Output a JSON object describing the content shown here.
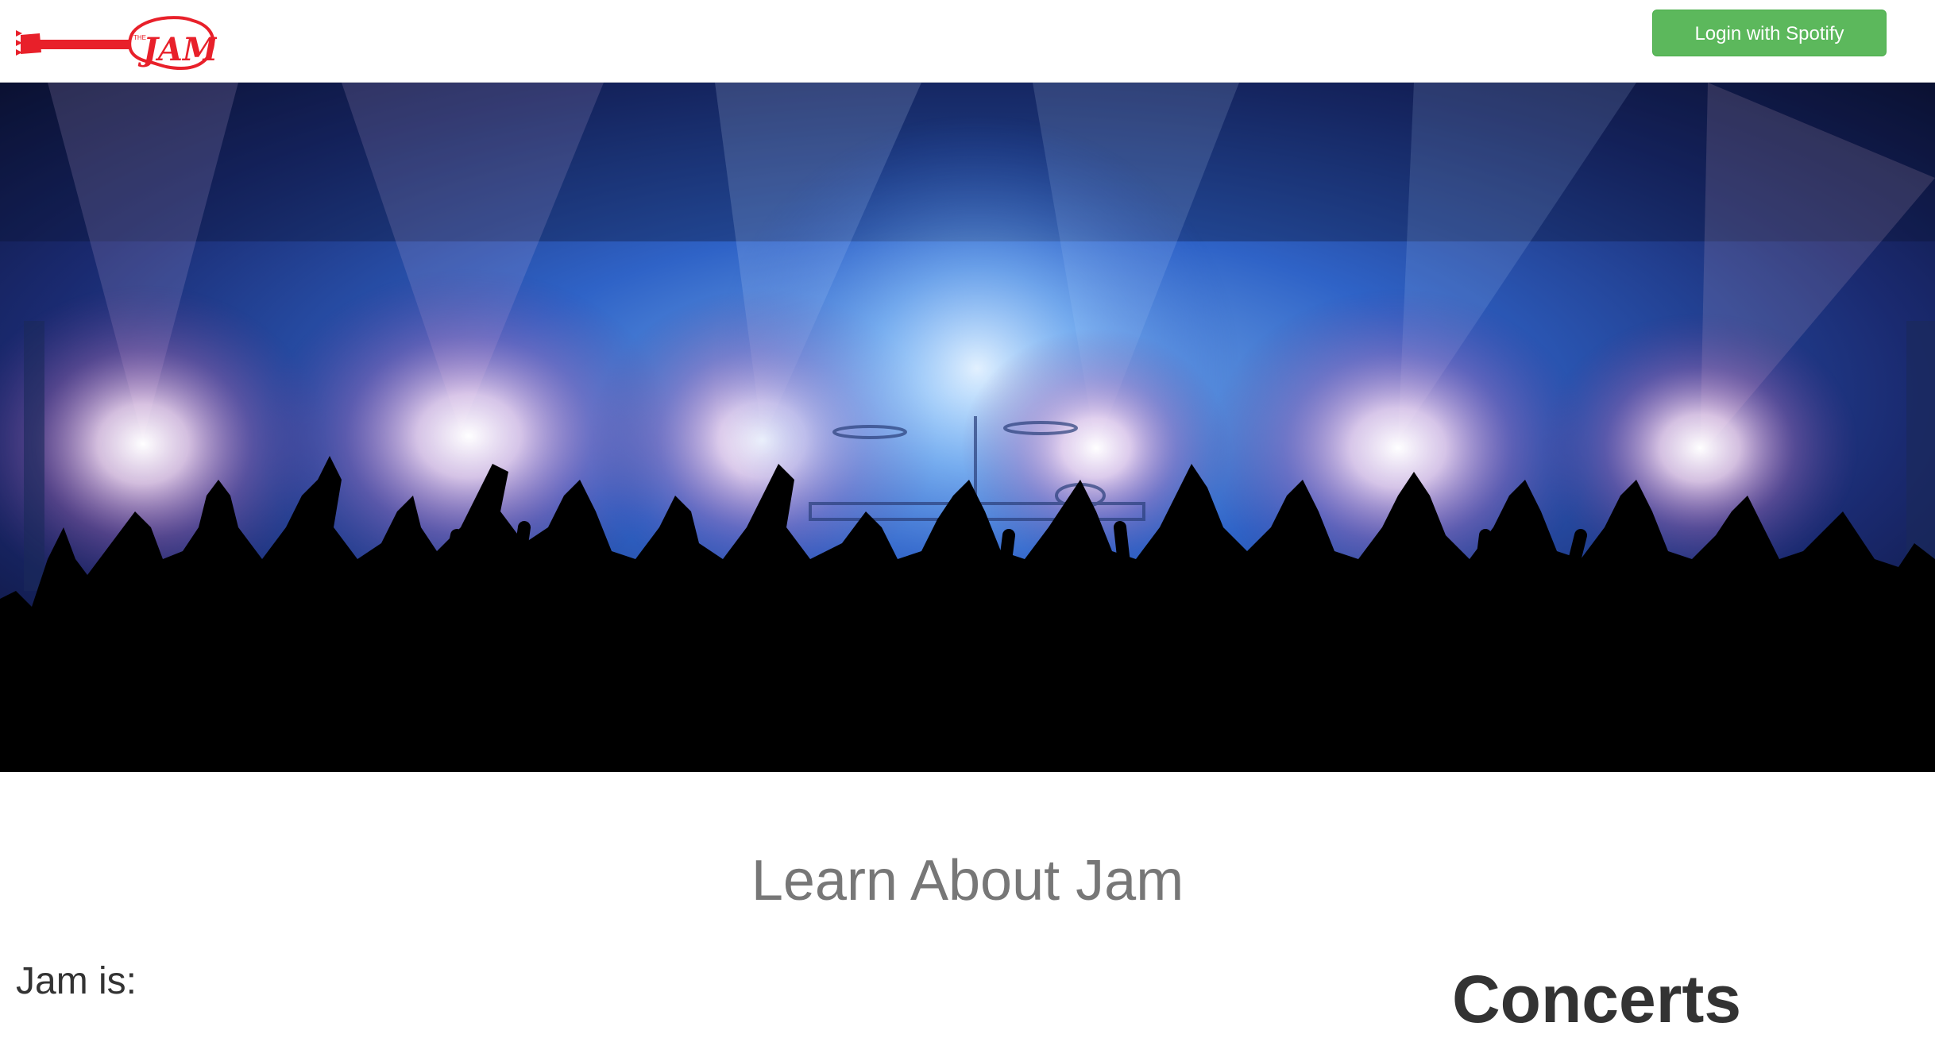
{
  "header": {
    "logo_small_text": "THE",
    "logo_text": "JAM",
    "login_button_label": "Login with Spotify"
  },
  "hero": {
    "image_description_icon": "concert-crowd-image"
  },
  "main": {
    "section_title": "Learn About Jam",
    "intro_heading": "Jam is:",
    "concerts_heading": "Concerts"
  },
  "colors": {
    "brand_red": "#e8202a",
    "login_green": "#5cb85c",
    "title_gray": "#777777",
    "text_dark": "#333333"
  }
}
